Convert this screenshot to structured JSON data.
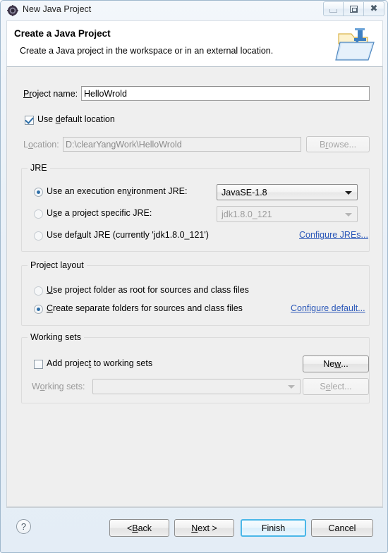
{
  "window": {
    "title": "New Java Project",
    "icon": "eclipse-icon",
    "controls": {
      "minimize": "minimize-icon",
      "maximize": "maximize-icon",
      "close": "close-icon"
    }
  },
  "header": {
    "title": "Create a Java Project",
    "description": "Create a Java project in the workspace or in an external location.",
    "icon": "java-project-folder-icon"
  },
  "project_name": {
    "label": "Project name:",
    "label_pre": "P",
    "label_mnemonic": "r",
    "label_post": "oject name:",
    "value": "HelloWrold"
  },
  "use_default_location": {
    "label_pre": "Use ",
    "label_mnemonic": "d",
    "label_post": "efault location",
    "checked": true
  },
  "location": {
    "label_pre": "L",
    "label_mnemonic": "o",
    "label_post": "cation:",
    "value": "D:\\clearYangWork\\HelloWrold",
    "browse_pre": "B",
    "browse_mnemonic": "r",
    "browse_post": "owse..."
  },
  "jre": {
    "group_title": "JRE",
    "execution_env": {
      "label_pre": "Use an execution en",
      "label_mnemonic": "v",
      "label_post": "ironment JRE:",
      "selected": true,
      "combo_value": "JavaSE-1.8"
    },
    "project_specific": {
      "label_pre": "U",
      "label_mnemonic": "s",
      "label_post": "e a project specific JRE:",
      "selected": false,
      "combo_value": "jdk1.8.0_121"
    },
    "default_jre": {
      "label_pre": "Use def",
      "label_mnemonic": "a",
      "label_post": "ult JRE (currently 'jdk1.8.0_121')",
      "selected": false
    },
    "configure_link": "Configure JREs..."
  },
  "project_layout": {
    "group_title": "Project layout",
    "root_option": {
      "label_pre": "",
      "label_mnemonic": "U",
      "label_post": "se project folder as root for sources and class files",
      "selected": false
    },
    "separate_option": {
      "label_pre": "",
      "label_mnemonic": "C",
      "label_post": "reate separate folders for sources and class files",
      "selected": true
    },
    "configure_link": "Configure default..."
  },
  "working_sets": {
    "group_title": "Working sets",
    "add_checkbox": {
      "label_pre": "Add projec",
      "label_mnemonic": "t",
      "label_post": " to working sets",
      "checked": false
    },
    "new_button": {
      "label_pre": "Ne",
      "label_mnemonic": "w",
      "label_post": "..."
    },
    "working_sets_label": {
      "label_pre": "W",
      "label_mnemonic": "o",
      "label_post": "rking sets:"
    },
    "working_sets_value": "",
    "select_button": {
      "label_pre": "S",
      "label_mnemonic": "e",
      "label_post": "lect..."
    }
  },
  "footer": {
    "help_icon": "help-icon",
    "back": {
      "label_pre": "< ",
      "label_mnemonic": "B",
      "label_post": "ack"
    },
    "next": {
      "label_pre": "",
      "label_mnemonic": "N",
      "label_post": "ext >"
    },
    "finish": "Finish",
    "cancel": "Cancel"
  },
  "colors": {
    "accent": "#2a57b8",
    "default_button_border": "#4ab7e8",
    "checkmark": "#2f6fa8"
  }
}
